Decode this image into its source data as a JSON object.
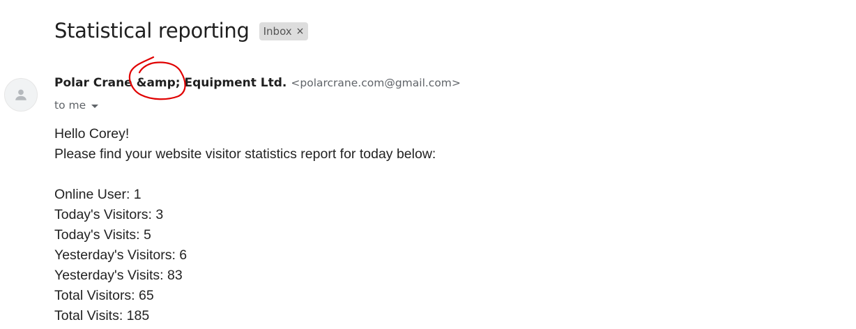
{
  "subject": "Statistical reporting",
  "label_chip": {
    "text": "Inbox",
    "remove_glyph": "×"
  },
  "sender": {
    "name": "Polar Crane &amp; Equipment Ltd.",
    "email": "<polarcrane.com@gmail.com>",
    "avatar_icon": "person-icon"
  },
  "recipient": {
    "text": "to me",
    "icon": "caret-down-icon"
  },
  "annotation": {
    "color": "#e00000",
    "icon": "red-circle-annotation"
  },
  "message": {
    "greeting": "Hello Corey!",
    "intro": "Please find your website visitor statistics report for today below:",
    "stats": [
      "Online User: 1",
      "Today's Visitors: 3",
      "Today's Visits: 5",
      "Yesterday's Visitors: 6",
      "Yesterday's Visits: 83",
      "Total Visitors: 65",
      "Total Visits: 185"
    ]
  }
}
